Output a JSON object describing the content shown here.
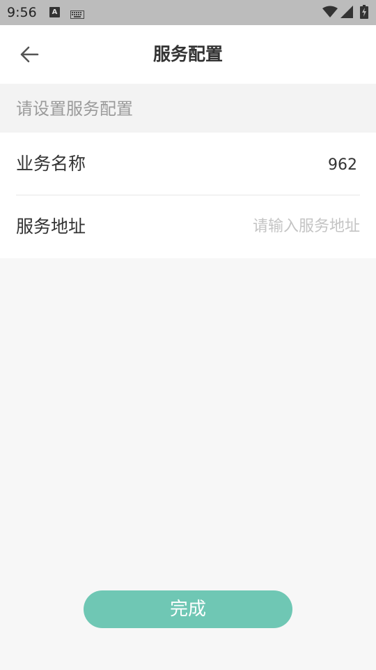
{
  "status_bar": {
    "time": "9:56",
    "app_icon_letter": "A",
    "icons": [
      "a-icon",
      "keyboard-icon",
      "wifi-icon",
      "signal-icon",
      "battery-charging-icon"
    ]
  },
  "header": {
    "title": "服务配置",
    "back_icon": "arrow-left-icon"
  },
  "section": {
    "hint": "请设置服务配置"
  },
  "form": {
    "business_name": {
      "label": "业务名称",
      "value": "962"
    },
    "service_address": {
      "label": "服务地址",
      "value": "",
      "placeholder": "请输入服务地址"
    }
  },
  "footer": {
    "done_label": "完成"
  },
  "colors": {
    "accent": "#6fc7b4",
    "status_bar": "#bcbcbc",
    "background": "#f7f7f7"
  }
}
